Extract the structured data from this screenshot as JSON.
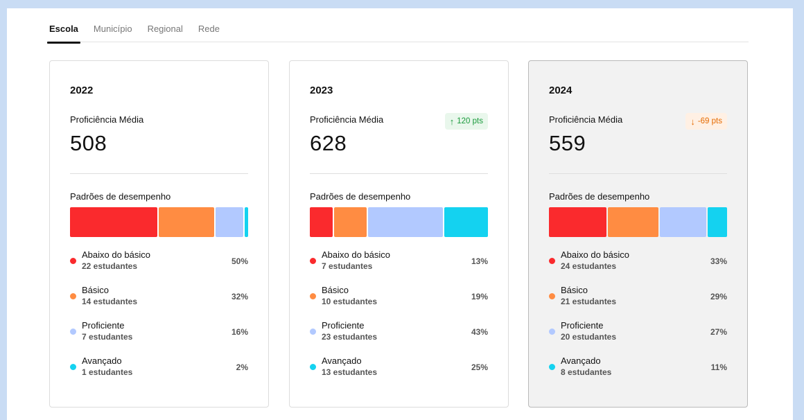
{
  "tabs": [
    {
      "label": "Escola",
      "active": true
    },
    {
      "label": "Município",
      "active": false
    },
    {
      "label": "Regional",
      "active": false
    },
    {
      "label": "Rede",
      "active": false
    }
  ],
  "colors": {
    "abaixo": "#fa2a2d",
    "basico": "#ff8c42",
    "proficiente": "#b2c9ff",
    "avancado": "#14d2f0",
    "badge_up_bg": "#e9f7ec",
    "badge_up_text": "#1a9a3c",
    "badge_down_bg": "#fff0e4",
    "badge_down_text": "#e56a00"
  },
  "cards": [
    {
      "year": "2022",
      "prof_label": "Proficiência Média",
      "prof_value": "508",
      "badge": null,
      "patterns_label": "Padrões de desempenho",
      "highlight": false,
      "levels": [
        {
          "name": "Abaixo do básico",
          "count": "22 estudantes",
          "pct_label": "50%",
          "pct": 50,
          "color_key": "abaixo"
        },
        {
          "name": "Básico",
          "count": "14 estudantes",
          "pct_label": "32%",
          "pct": 32,
          "color_key": "basico"
        },
        {
          "name": "Proficiente",
          "count": "7 estudantes",
          "pct_label": "16%",
          "pct": 16,
          "color_key": "proficiente"
        },
        {
          "name": "Avançado",
          "count": "1 estudantes",
          "pct_label": "2%",
          "pct": 2,
          "color_key": "avancado"
        }
      ]
    },
    {
      "year": "2023",
      "prof_label": "Proficiência Média",
      "prof_value": "628",
      "badge": {
        "direction": "up",
        "arrow_icon": "arrow-up-icon",
        "text": "120 pts"
      },
      "patterns_label": "Padrões de desempenho",
      "highlight": false,
      "levels": [
        {
          "name": "Abaixo do básico",
          "count": "7 estudantes",
          "pct_label": "13%",
          "pct": 13,
          "color_key": "abaixo"
        },
        {
          "name": "Básico",
          "count": "10 estudantes",
          "pct_label": "19%",
          "pct": 19,
          "color_key": "basico"
        },
        {
          "name": "Proficiente",
          "count": "23 estudantes",
          "pct_label": "43%",
          "pct": 43,
          "color_key": "proficiente"
        },
        {
          "name": "Avançado",
          "count": "13 estudantes",
          "pct_label": "25%",
          "pct": 25,
          "color_key": "avancado"
        }
      ]
    },
    {
      "year": "2024",
      "prof_label": "Proficiência Média",
      "prof_value": "559",
      "badge": {
        "direction": "down",
        "arrow_icon": "arrow-down-icon",
        "text": "-69 pts"
      },
      "patterns_label": "Padrões de desempenho",
      "highlight": true,
      "levels": [
        {
          "name": "Abaixo do básico",
          "count": "24 estudantes",
          "pct_label": "33%",
          "pct": 33,
          "color_key": "abaixo"
        },
        {
          "name": "Básico",
          "count": "21 estudantes",
          "pct_label": "29%",
          "pct": 29,
          "color_key": "basico"
        },
        {
          "name": "Proficiente",
          "count": "20 estudantes",
          "pct_label": "27%",
          "pct": 27,
          "color_key": "proficiente"
        },
        {
          "name": "Avançado",
          "count": "8 estudantes",
          "pct_label": "11%",
          "pct": 11,
          "color_key": "avancado"
        }
      ]
    }
  ]
}
